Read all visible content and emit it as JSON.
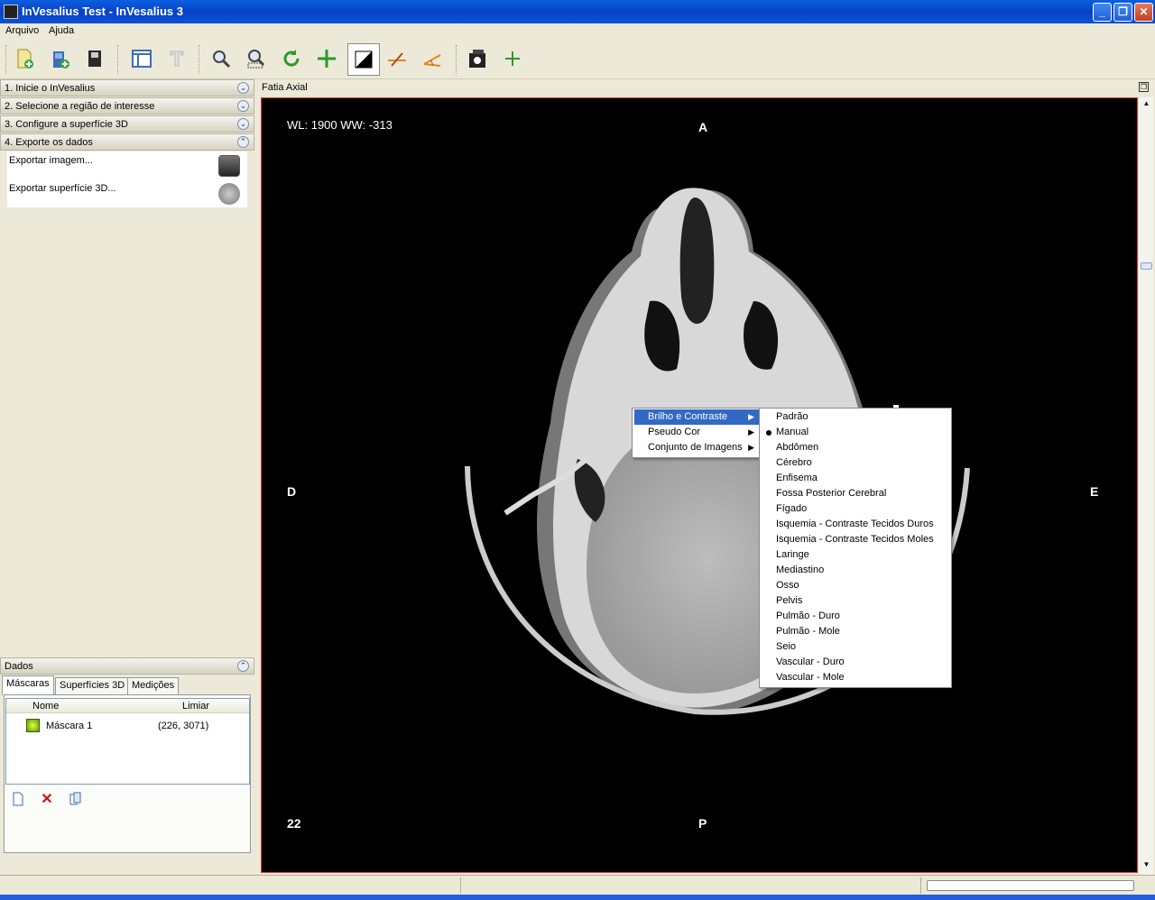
{
  "window": {
    "title": "InVesalius Test - InVesalius 3"
  },
  "menu": {
    "items": [
      "Arquivo",
      "Ajuda"
    ]
  },
  "toolbar": {
    "tools": [
      "import-icon",
      "open-icon",
      "save-icon",
      "layout-icon",
      "text-icon",
      "zoom-icon",
      "zoom-select-icon",
      "rotate-icon",
      "pan-icon",
      "contrast-icon",
      "measure-linear-icon",
      "measure-angle-icon",
      "snapshot-icon",
      "add-icon"
    ]
  },
  "left_panel": {
    "steps": [
      "1. Inicie o InVesalius",
      "2. Selecione a região de interesse",
      "3. Configure a superfície 3D",
      "4. Exporte os dados"
    ],
    "export_items": [
      "Exportar imagem...",
      "Exportar superfície 3D..."
    ],
    "dados": {
      "title": "Dados",
      "tabs": [
        "Máscaras",
        "Superfícies 3D",
        "Medições"
      ],
      "columns": [
        "Nome",
        "Limiar"
      ],
      "rows": [
        {
          "name": "Máscara 1",
          "threshold": "(226, 3071)",
          "color": "#8fd400"
        }
      ]
    }
  },
  "viewer": {
    "title": "Fatia Axial",
    "wlww": "WL: 1900  WW: -313",
    "orientation": {
      "top": "A",
      "bottom": "P",
      "left": "D",
      "right": "E"
    },
    "slice_number": "22"
  },
  "context_menu": {
    "items": [
      "Brilho e Contraste",
      "Pseudo Cor",
      "Conjunto de Imagens"
    ],
    "submenu": [
      "Padrão",
      "Manual",
      "Abdômen",
      "Cérebro",
      "Enfisema",
      "Fossa Posterior Cerebral",
      "Fígado",
      "Isquemia - Contraste Tecidos Duros",
      "Isquemia - Contraste Tecidos Moles",
      "Laringe",
      "Mediastino",
      "Osso",
      "Pelvis",
      "Pulmão - Duro",
      "Pulmão - Mole",
      "Seio",
      "Vascular - Duro",
      "Vascular - Mole"
    ],
    "submenu_selected": "Manual"
  }
}
